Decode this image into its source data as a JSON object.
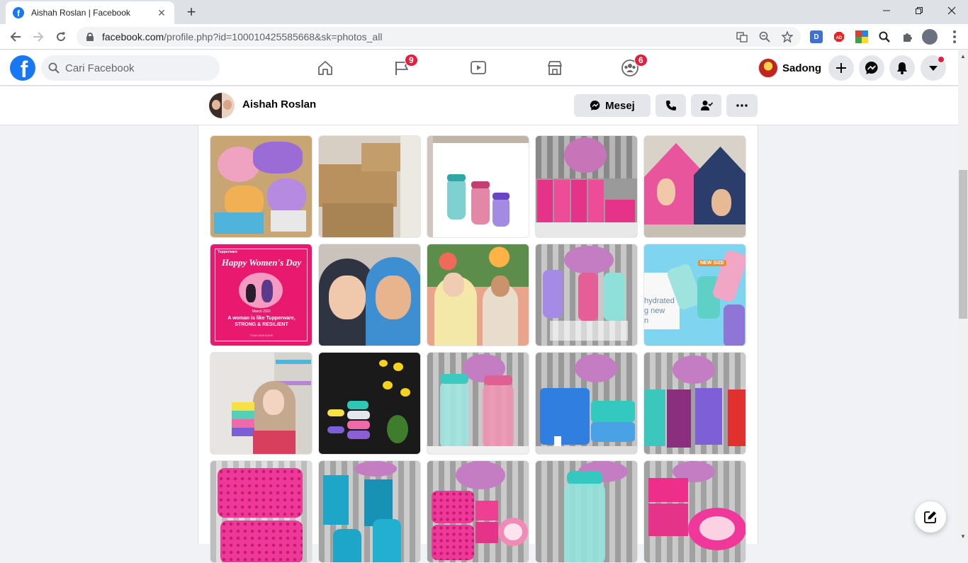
{
  "browser": {
    "tab_title": "Aishah Roslan | Facebook",
    "tab_close": "✕",
    "new_tab": "+",
    "url_host": "facebook.com",
    "url_path": "/profile.php?id=100010425585668&sk=photos_all",
    "window_controls": {
      "minimize": "—",
      "restore": "❐",
      "close": "✕"
    }
  },
  "facebook": {
    "logo_letter": "f",
    "search_placeholder": "Cari Facebook",
    "nav_badges": {
      "pages": "9",
      "groups": "6"
    },
    "account_name": "Sadong"
  },
  "profile": {
    "name": "Aishah Roslan",
    "message_button": "Mesej"
  },
  "photos": [
    {
      "subject": "boxes of colourful Tupperware"
    },
    {
      "subject": "stacked cardboard boxes"
    },
    {
      "subject": "three water bottles"
    },
    {
      "subject": "pink containers with orchids"
    },
    {
      "subject": "children in play tent"
    },
    {
      "subject": "Happy Women's Day poster",
      "text_title": "Happy Women's Day",
      "text_brand": "Tupperware",
      "text_date": "March 2021",
      "text_line1": "A woman is like Tupperware,",
      "text_line2": "STRONG & RESILIENT",
      "text_footer": "TEAM AWESOME"
    },
    {
      "subject": "two women selfie"
    },
    {
      "subject": "family portrait"
    },
    {
      "subject": "three bottles on stand"
    },
    {
      "subject": "new size bottles",
      "text_badge": "NEW SIZE",
      "text_line1": "hydrated",
      "text_line2": "g new",
      "text_line3": "n"
    },
    {
      "subject": "woman holding stacked containers"
    },
    {
      "subject": "stacked bowls with yellow orchid"
    },
    {
      "subject": "two large bottles"
    },
    {
      "subject": "blue water dispenser"
    },
    {
      "subject": "tall square containers"
    },
    {
      "subject": "pink storage baskets"
    },
    {
      "subject": "teal containers"
    },
    {
      "subject": "pink baskets and bowl"
    },
    {
      "subject": "teal bottle"
    },
    {
      "subject": "pink square containers"
    }
  ],
  "colors": {
    "fb_blue": "#1877f2",
    "badge_red": "#e41e3f"
  }
}
